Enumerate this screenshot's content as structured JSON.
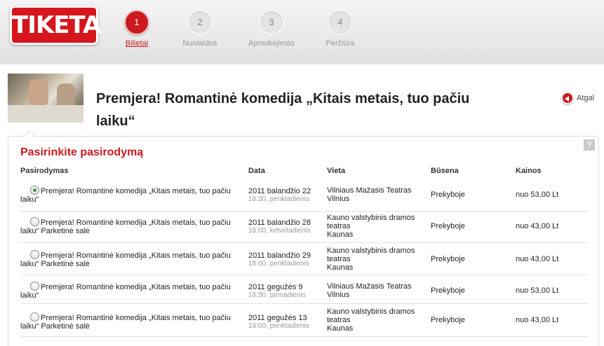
{
  "brand": {
    "logo_text": "TIKETA"
  },
  "steps": [
    {
      "number": "1",
      "label": "Bilietai",
      "active": true
    },
    {
      "number": "2",
      "label": "Nuolaidos",
      "active": false
    },
    {
      "number": "3",
      "label": "Apmokėjimas",
      "active": false
    },
    {
      "number": "4",
      "label": "Peržiūra",
      "active": false
    }
  ],
  "event": {
    "title": "Premjera! Romantinė komedija „Kitais metais, tuo pačiu laiku“",
    "back_label": "Atgal"
  },
  "panel": {
    "title": "Pasirinkite pasirodymą",
    "help_label": "?",
    "columns": {
      "show": "Pasirodymas",
      "date": "Data",
      "venue": "Vieta",
      "status": "Būsena",
      "price": "Kainos"
    },
    "rows": [
      {
        "selected": true,
        "name": "Premjera! Romantinė komedija „Kitais metais, tuo pačiu laiku“",
        "date": "2011 balandžio 22",
        "time": "18:30, penktadienis",
        "venue": "Vilniaus Mažasis Teatras\nVilnius",
        "status": "Prekyboje",
        "price": "nuo 53,00 Lt"
      },
      {
        "selected": false,
        "name": "Premjera! Romantinė komedija „Kitais metais, tuo pačiu laiku“ Parketinė salė",
        "date": "2011 balandžio 28",
        "time": "18:00, ketvirtadienis",
        "venue": "Kauno valstybinis dramos teatras\nKaunas",
        "status": "Prekyboje",
        "price": "nuo 43,00 Lt"
      },
      {
        "selected": false,
        "name": "Premjera! Romantinė komedija „Kitais metais, tuo pačiu laiku“ Parketinė salė",
        "date": "2011 balandžio 29",
        "time": "18:00, penktadienis",
        "venue": "Kauno valstybinis dramos teatras\nKaunas",
        "status": "Prekyboje",
        "price": "nuo 43,00 Lt"
      },
      {
        "selected": false,
        "name": "Premjera! Romantinė komedija „Kitais metais, tuo pačiu laiku“",
        "date": "2011 gegužės 9",
        "time": "18:30, pirmadienis",
        "venue": "Vilniaus Mažasis Teatras\nVilnius",
        "status": "Prekyboje",
        "price": "nuo 53,00 Lt"
      },
      {
        "selected": false,
        "name": "Premjera! Romantinė komedija „Kitais metais, tuo pačiu laiku“ Parketinė salė",
        "date": "2011 gegužės 13",
        "time": "19:00, penktadienis",
        "venue": "Kauno valstybinis dramos teatras\nKaunas",
        "status": "Prekyboje",
        "price": "nuo 43,00 Lt"
      }
    ]
  },
  "colors": {
    "accent": "#cc1a20",
    "logo_bg": "#d6161d",
    "radio_checked": "#2c9e3a"
  }
}
